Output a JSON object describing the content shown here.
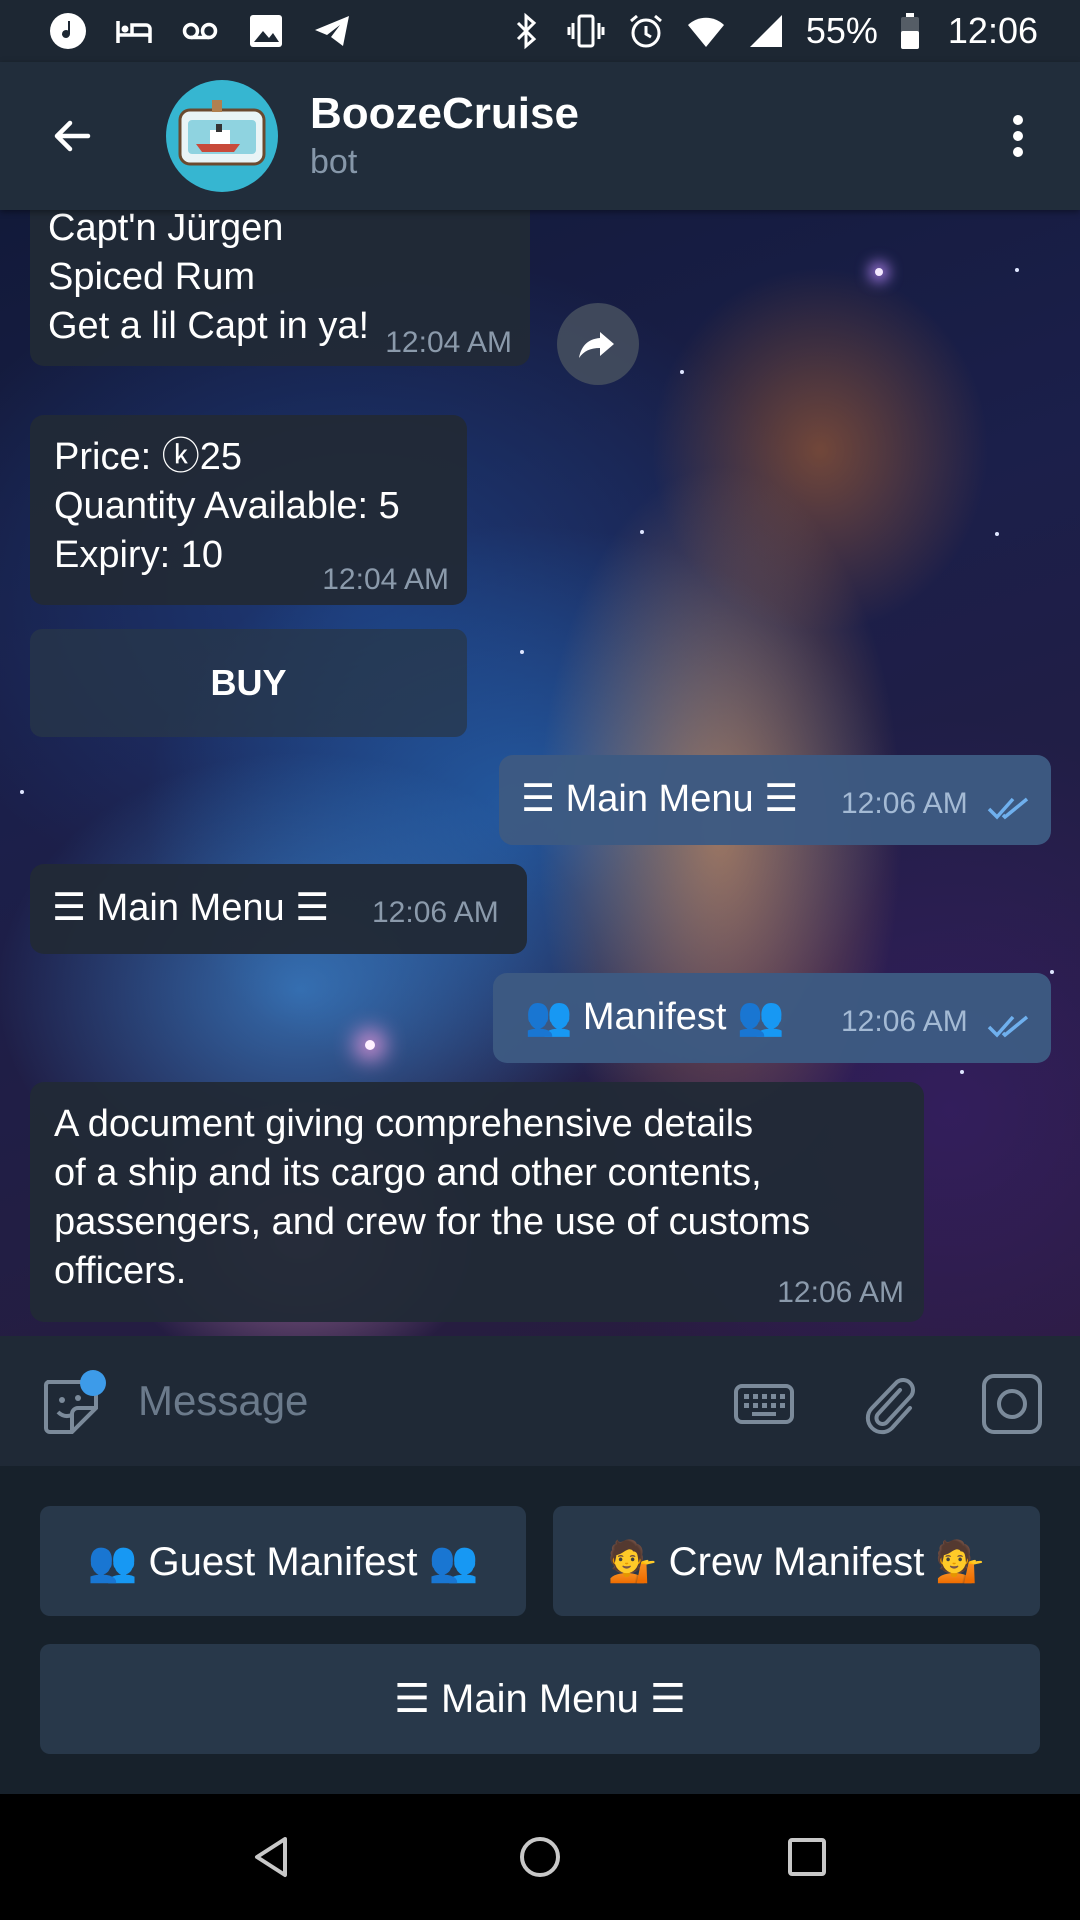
{
  "status_bar": {
    "battery": "55%",
    "time": "12:06",
    "icons": [
      "music-icon",
      "bed-icon",
      "voicemail-icon",
      "image-icon",
      "telegram-icon",
      "bluetooth-icon",
      "vibrate-icon",
      "alarm-icon",
      "wifi-icon",
      "signal-icon",
      "battery-icon"
    ]
  },
  "header": {
    "title": "BoozeCruise",
    "subtitle": "bot"
  },
  "messages": [
    {
      "direction": "in",
      "text": "Capt'n Jürgen\nSpiced Rum\nGet a lil Capt in ya!",
      "time": "12:04 AM"
    },
    {
      "direction": "in",
      "text": "Price: ⓚ25\nQuantity Available: 5\nExpiry: 10",
      "time": "12:04 AM"
    },
    {
      "direction": "out",
      "text": "☰ Main Menu ☰",
      "time": "12:06 AM",
      "read": true
    },
    {
      "direction": "in",
      "text": "☰ Main Menu ☰",
      "time": "12:06 AM"
    },
    {
      "direction": "out",
      "text": "👥 Manifest 👥",
      "time": "12:06 AM",
      "read": true
    },
    {
      "direction": "in",
      "text": "A document giving comprehensive details\nof a ship and its cargo and other contents,\npassengers, and crew for the use of customs\nofficers.",
      "time": "12:06 AM"
    }
  ],
  "inline_button": {
    "label": "BUY"
  },
  "input": {
    "placeholder": "Message"
  },
  "reply_keyboard": {
    "guest_manifest": "👥 Guest Manifest 👥",
    "crew_manifest": "💁 Crew Manifest 💁",
    "main_menu": "☰ Main Menu ☰"
  },
  "colors": {
    "header_bg": "#212d3b",
    "incoming_bubble": "#212a36",
    "outgoing_bubble": "#3d5a82",
    "accent": "#3d9be9"
  }
}
